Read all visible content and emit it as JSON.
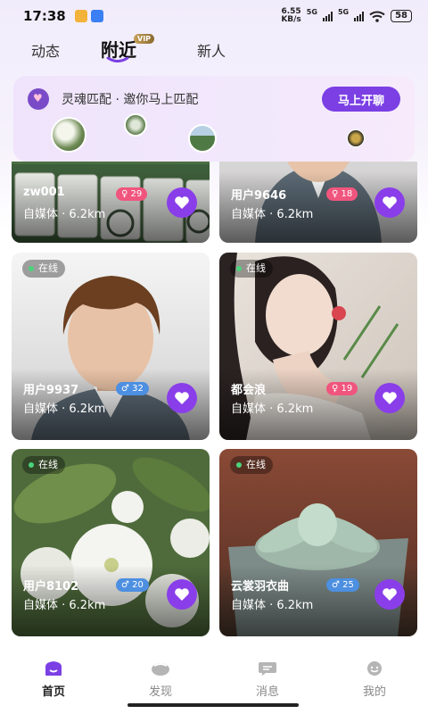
{
  "status_bar": {
    "time": "17:38",
    "net_speed_value": "6.55",
    "net_speed_unit": "KB/s",
    "network_type_1": "5G",
    "network_type_2": "5G",
    "battery": "58"
  },
  "tabs": [
    {
      "label": "动态",
      "active": false
    },
    {
      "label": "附近",
      "active": true,
      "badge": "VIP"
    },
    {
      "label": "新人",
      "active": false
    }
  ],
  "match_banner": {
    "title": "灵魂匹配 · 邀你马上匹配",
    "button_label": "马上开聊"
  },
  "cards": [
    {
      "name": "zw001",
      "badge_value": "29",
      "badge_type": "female",
      "online": false,
      "meta": "自媒体 · 6.2km",
      "photo": "mahjong tiles"
    },
    {
      "name": "用户9646",
      "badge_value": "18",
      "badge_type": "female",
      "online": false,
      "meta": "自媒体 · 6.2km",
      "photo": "default avatar female"
    },
    {
      "name": "用户9937",
      "badge_value": "32",
      "badge_type": "male",
      "online": true,
      "online_label": "在线",
      "meta": "自媒体 · 6.2km",
      "photo": "default avatar male"
    },
    {
      "name": "都会浪",
      "badge_value": "19",
      "badge_type": "female",
      "online": true,
      "online_label": "在线",
      "meta": "自媒体 · 6.2km",
      "photo": "portrait woman"
    },
    {
      "name": "用户8102",
      "badge_value": "20",
      "badge_type": "male",
      "online": true,
      "online_label": "在线",
      "meta": "自媒体 · 6.2km",
      "photo": "white flowers"
    },
    {
      "name": "云裳羽衣曲",
      "badge_value": "25",
      "badge_type": "male",
      "online": true,
      "online_label": "在线",
      "meta": "自媒体 · 6.2km",
      "photo": "succulent plant"
    }
  ],
  "bottom_nav": [
    {
      "label": "首页",
      "active": true,
      "icon": "home-icon"
    },
    {
      "label": "发现",
      "active": false,
      "icon": "discover-icon"
    },
    {
      "label": "消息",
      "active": false,
      "icon": "message-icon"
    },
    {
      "label": "我的",
      "active": false,
      "icon": "profile-icon"
    }
  ],
  "colors": {
    "accent": "#7b3fe4",
    "like_button": "#8a3ee9",
    "female_badge": "#f0557e",
    "male_badge": "#4d8fe0",
    "online_dot": "#4bd37c"
  }
}
